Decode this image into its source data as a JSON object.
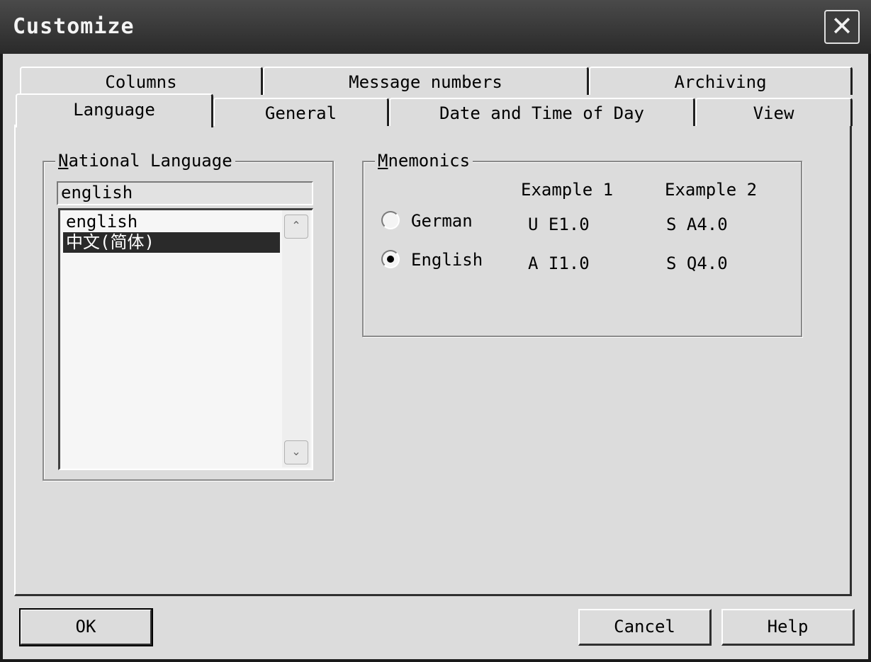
{
  "window": {
    "title": "Customize",
    "close_symbol": "✕"
  },
  "tabs": {
    "row1": [
      "Columns",
      "Message numbers",
      "Archiving"
    ],
    "row2": [
      "Language",
      "General",
      "Date and Time of Day",
      "View"
    ],
    "active": "Language"
  },
  "national_language": {
    "legend_accel": "N",
    "legend_rest": "ational Language",
    "combo_value": "english",
    "items": [
      "english",
      "中文(简体)"
    ],
    "selected_item": "中文(简体)",
    "scroll_up_symbol": "⌃",
    "scroll_down_symbol": "⌄"
  },
  "mnemonics": {
    "legend_accel": "M",
    "legend_rest": "nemonics",
    "col1_header": "Example 1",
    "col2_header": "Example 2",
    "options": [
      {
        "label": "German",
        "example1": "U E1.0",
        "example2": "S A4.0",
        "selected": false
      },
      {
        "label": "English",
        "example1": "A I1.0",
        "example2": "S Q4.0",
        "selected": true
      }
    ]
  },
  "buttons": {
    "ok": "OK",
    "cancel": "Cancel",
    "help": "Help"
  }
}
